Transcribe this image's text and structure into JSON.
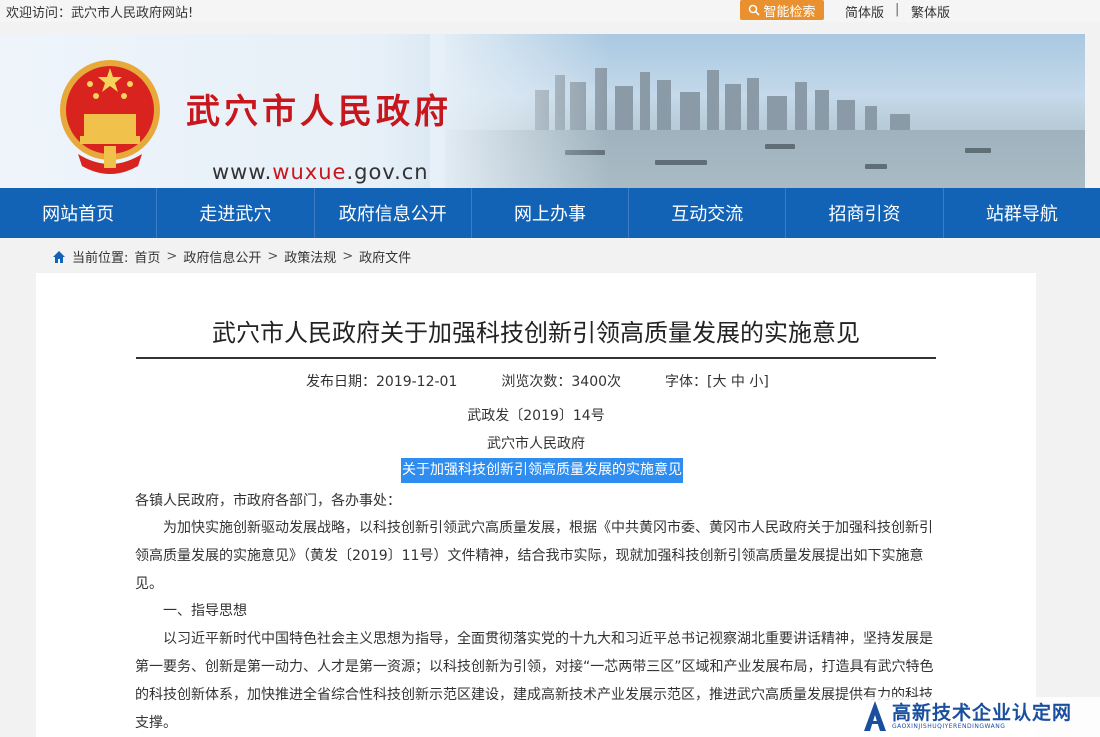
{
  "topbar": {
    "welcome": "欢迎访问：武穴市人民政府网站!",
    "search_button": "智能检索",
    "lang_simplified": "简体版",
    "separator": "|",
    "lang_traditional": "繁体版"
  },
  "banner": {
    "site_title": "武穴市人民政府",
    "url_prefix": "www.",
    "url_highlight": "wuxue",
    "url_suffix": ".gov.cn"
  },
  "nav": {
    "items": [
      "网站首页",
      "走进武穴",
      "政府信息公开",
      "网上办事",
      "互动交流",
      "招商引资",
      "站群导航"
    ]
  },
  "breadcrumb": {
    "label": "当前位置:",
    "items": [
      "首页",
      "政府信息公开",
      "政策法规",
      "政府文件"
    ],
    "separator": ">"
  },
  "article": {
    "title": "武穴市人民政府关于加强科技创新引领高质量发展的实施意见",
    "publish_date": "发布日期：2019-12-01",
    "views": "浏览次数：3400次",
    "font_size": "字体：[大 中 小]",
    "doc_number": "武政发〔2019〕14号",
    "issuer": "武穴市人民政府",
    "selected_title": "关于加强科技创新引领高质量发展的实施意见",
    "salutation": "各镇人民政府，市政府各部门，各办事处：",
    "para1": "为加快实施创新驱动发展战略，以科技创新引领武穴高质量发展，根据《中共黄冈市委、黄冈市人民政府关于加强科技创新引领高质量发展的实施意见》（黄发〔2019〕11号）文件精神，结合我市实际，现就加强科技创新引领高质量发展提出如下实施意见。",
    "heading1": "一、指导思想",
    "para2": "以习近平新时代中国特色社会主义思想为指导，全面贯彻落实党的十九大和习近平总书记视察湖北重要讲话精神，坚持发展是第一要务、创新是第一动力、人才是第一资源；以科技创新为引领，对接“一芯两带三区”区域和产业发展布局，打造具有武穴特色的科技创新体系，加快推进全省综合性科技创新示范区建设，建成高新技术产业发展示范区，推进武穴高质量发展提供有力的科技支撑。"
  },
  "watermark": {
    "text": "高新技术企业认定网",
    "sub": "GAOXINJISHUQIYERENDINGWANG"
  },
  "colors": {
    "nav_bg": "#1262b6",
    "title_red": "#c8161d",
    "search_orange": "#e8912e",
    "selection_blue": "#2f8df0"
  },
  "icons": {
    "search": "search-icon",
    "home": "home-icon",
    "emblem": "national-emblem-icon"
  }
}
